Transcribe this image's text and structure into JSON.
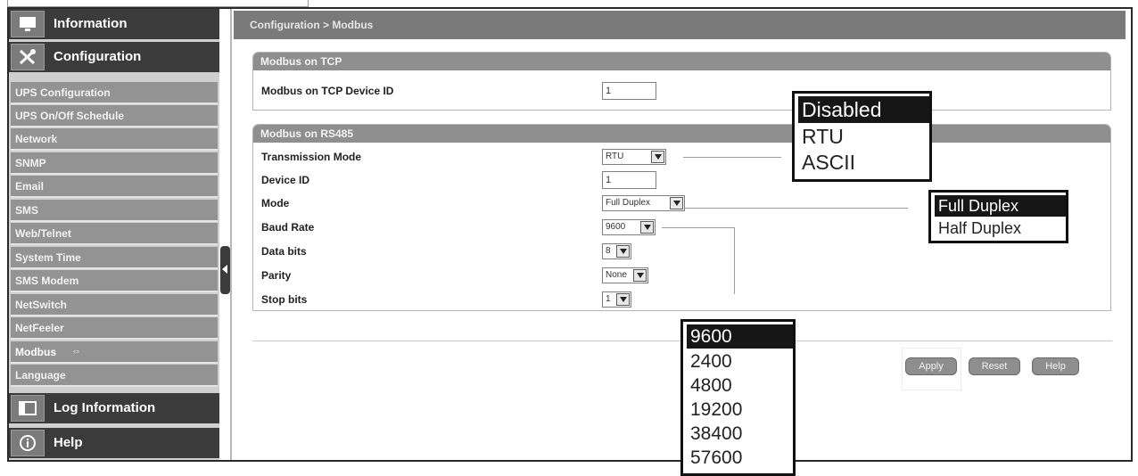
{
  "sidebar": {
    "information_label": "Information",
    "configuration_label": "Configuration",
    "items": [
      {
        "label": "UPS Configuration"
      },
      {
        "label": "UPS On/Off Schedule"
      },
      {
        "label": "Network"
      },
      {
        "label": "SNMP"
      },
      {
        "label": "Email"
      },
      {
        "label": "SMS"
      },
      {
        "label": "Web/Telnet"
      },
      {
        "label": "System Time"
      },
      {
        "label": "SMS Modem"
      },
      {
        "label": "NetSwitch"
      },
      {
        "label": "NetFeeler"
      },
      {
        "label": "Modbus",
        "active": true
      },
      {
        "label": "Language"
      }
    ],
    "log_information_label": "Log Information",
    "help_label": "Help"
  },
  "breadcrumb": "Configuration > Modbus",
  "modbus_tcp": {
    "title": "Modbus on TCP",
    "device_id_label": "Modbus on TCP Device ID",
    "device_id_value": "1"
  },
  "modbus_rs485": {
    "title": "Modbus on RS485",
    "transmission_mode_label": "Transmission Mode",
    "transmission_mode_value": "RTU",
    "device_id_label": "Device ID",
    "device_id_value": "1",
    "mode_label": "Mode",
    "mode_value": "Full Duplex",
    "baud_rate_label": "Baud Rate",
    "baud_rate_value": "9600",
    "data_bits_label": "Data bits",
    "data_bits_value": "8",
    "parity_label": "Parity",
    "parity_value": "None",
    "stop_bits_label": "Stop bits",
    "stop_bits_value": "1"
  },
  "buttons": {
    "apply": "Apply",
    "reset": "Reset",
    "help": "Help"
  },
  "popups": {
    "transmission_mode_options": [
      "Disabled",
      "RTU",
      "ASCII"
    ],
    "mode_options": [
      "Full Duplex",
      "Half Duplex"
    ],
    "baud_rate_options": [
      "9600",
      "2400",
      "4800",
      "19200",
      "38400",
      "57600"
    ]
  },
  "icons": {
    "information": "monitor-icon",
    "configuration": "tools-icon",
    "log_information": "log-window-icon",
    "help": "info-circle-icon",
    "modbus_active_marker": "arrows-icon"
  },
  "colors": {
    "category_bg": "#3b3b3b",
    "subitem_bg": "#939393",
    "panel_header_bg": "#8f8f8f",
    "breadcrumb_bg": "#7a7a7a",
    "button_bg": "#8e8e8e",
    "selected_option_bg": "#161616"
  }
}
